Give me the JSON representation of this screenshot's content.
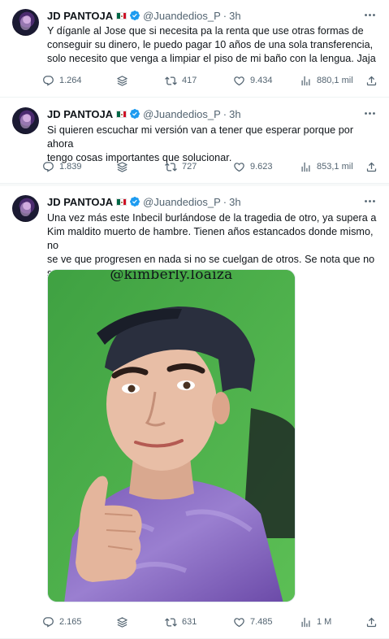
{
  "tweets": [
    {
      "name": "JD PANTOJA",
      "handle": "@Juandedios_P",
      "time": "3h",
      "text": "Y díganle al Jose que si necesita pa la renta que use otras formas de\nconseguir su dinero, le puedo pagar 10 años de una sola transferencia,\nsolo necesito que venga a limpiar el piso de mi baño con la lengua. Jaja",
      "replies": "1.264",
      "retweets": "417",
      "likes": "9.434",
      "views": "880,1 mil"
    },
    {
      "name": "JD PANTOJA",
      "handle": "@Juandedios_P",
      "time": "3h",
      "text": "Si quieren escuchar mi versión van a tener que esperar porque por ahora\ntengo cosas importantes que solucionar.",
      "replies": "1.839",
      "retweets": "727",
      "likes": "9.623",
      "views": "853,1 mil"
    },
    {
      "name": "JD PANTOJA",
      "handle": "@Juandedios_P",
      "time": "3h",
      "text": "Una vez más este Inbecil burlándose de la tragedia de otro, ya supera a\nKim maldito muerto de hambre. Tienen años estancados donde mismo, no\nse ve que progresen en nada si no se cuelgan de otros. Se nota que no se\nquieren regresar a su país, los veo desesperados.",
      "media_caption": "@kimberly.loaiza",
      "replies": "2.165",
      "retweets": "631",
      "likes": "7.485",
      "views": "1 M"
    }
  ],
  "icons": {
    "more": "more-dots-icon",
    "verified": "verified-badge-icon",
    "reply": "reply-bubble-icon",
    "stack": "stack-layers-icon",
    "retweet": "retweet-icon",
    "like": "heart-icon",
    "views": "views-bars-icon",
    "share": "share-upload-icon"
  },
  "colors": {
    "verified": "#1d9bf0",
    "secondary_text": "#536471",
    "media_background": "#4caf50"
  }
}
